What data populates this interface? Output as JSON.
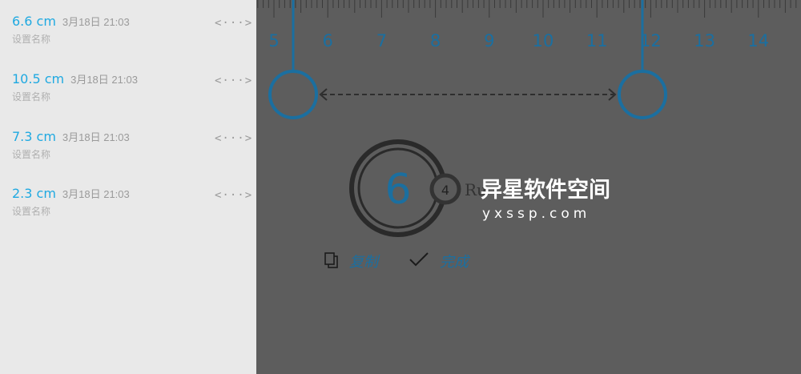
{
  "sidebar": {
    "items": [
      {
        "value": "6.6 cm",
        "timestamp": "3月18日 21:03",
        "name": "设置名称",
        "icon": "measure-arrow-icon"
      },
      {
        "value": "10.5 cm",
        "timestamp": "3月18日 21:03",
        "name": "设置名称",
        "icon": "measure-arrow-icon"
      },
      {
        "value": "7.3 cm",
        "timestamp": "3月18日 21:03",
        "name": "设置名称",
        "icon": "measure-arrow-icon"
      },
      {
        "value": "2.3 cm",
        "timestamp": "3月18日 21:03",
        "name": "设置名称",
        "icon": "measure-arrow-icon"
      }
    ]
  },
  "ruler": {
    "tick_labels": [
      "5",
      "6",
      "7",
      "8",
      "9",
      "10",
      "11",
      "12",
      "13",
      "14"
    ]
  },
  "measurement": {
    "main_value": "6",
    "fraction_value": "4",
    "unit_partial": "Ru"
  },
  "actions": {
    "copy_label": "复制",
    "done_label": "完成"
  },
  "watermark": {
    "title": "异星软件空间",
    "url": "yxssp.com"
  },
  "colors": {
    "accent": "#1fa9e1",
    "handle": "#1b6fa0",
    "background": "#5d5d5d",
    "sidebar": "#e9e9e9"
  }
}
